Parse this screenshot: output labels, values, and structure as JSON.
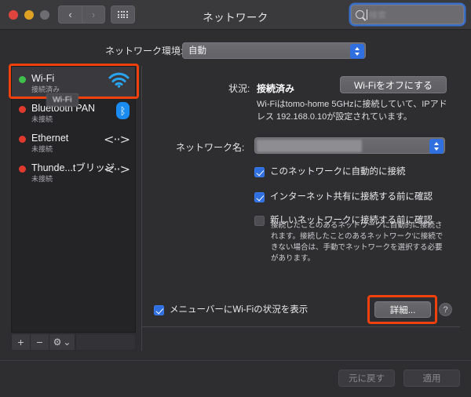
{
  "window": {
    "title": "ネットワーク",
    "traffic_lights": [
      "close",
      "minimize",
      "zoom"
    ]
  },
  "search": {
    "placeholder": "検索",
    "value": "",
    "icon": "search-icon"
  },
  "toolbar": {
    "back_icon": "chevron-left-icon",
    "forward_icon": "chevron-right-icon",
    "grid_icon": "show-all-grid-icon"
  },
  "location": {
    "label": "ネットワーク環境:",
    "selected": "自動"
  },
  "sidebar": {
    "services": [
      {
        "name": "Wi-Fi",
        "status": "接続済み",
        "dot": "green",
        "icon": "wifi-icon",
        "selected": true,
        "highlighted": true
      },
      {
        "name": "Bluetooth PAN",
        "status": "未接続",
        "dot": "red",
        "icon": "bluetooth-icon",
        "selected": false,
        "highlighted": false
      },
      {
        "name": "Ethernet",
        "status": "未接続",
        "dot": "red",
        "icon": "ethernet-icon",
        "selected": false,
        "highlighted": false
      },
      {
        "name": "Thunde...tブリッジ",
        "status": "未接続",
        "dot": "red",
        "icon": "ethernet-icon",
        "selected": false,
        "highlighted": false
      }
    ],
    "tooltip": "Wi-Fi",
    "toolbar": {
      "add": "+",
      "remove": "−",
      "action": "⚙",
      "action_chevron": "⌄"
    }
  },
  "main": {
    "status_label": "状況:",
    "status_value": "接続済み",
    "toggle_button": "Wi-Fiをオフにする",
    "status_description": "Wi-Fiはtomo-home 5GHzに接続していて、IPアドレス 192.168.0.10が設定されています。",
    "network_name_label": "ネットワーク名:",
    "network_name_value": "",
    "checkboxes": [
      {
        "label": "このネットワークに自動的に接続",
        "checked": true
      },
      {
        "label": "インターネット共有に接続する前に確認",
        "checked": true
      },
      {
        "label": "新しいネットワークに接続する前に確認",
        "checked": false
      }
    ],
    "help_text": "接続したことのあるネットワークに自動的に接続されます。接続したことのあるネットワーク'に接続できない場合は、手動でネットワークを選択する必要があります。",
    "menubar_checkbox": {
      "label": "メニューバーにWi-Fiの状況を表示",
      "checked": true
    },
    "detail_button": "詳細...",
    "help_button": "?"
  },
  "footer": {
    "revert_button": "元に戻す",
    "apply_button": "適用"
  },
  "colors": {
    "accent_blue": "#2f6fe0",
    "highlight_orange": "#f0400c",
    "status_connected": "#3fc04b",
    "status_disconnected": "#e0392e",
    "window_bg": "#2e2e31",
    "sidebar_bg": "#242427"
  }
}
